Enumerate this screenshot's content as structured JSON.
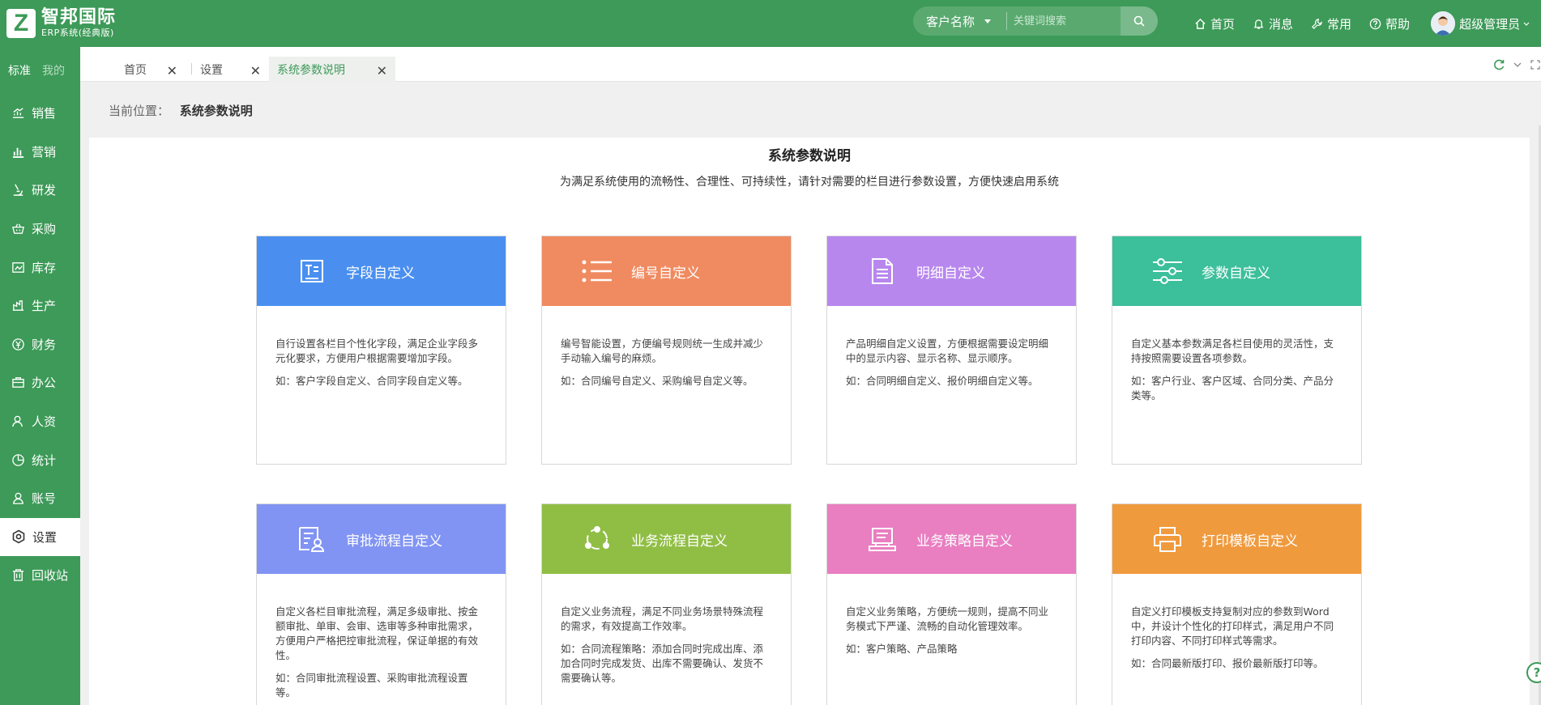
{
  "header": {
    "logo_letter": "Z",
    "logo_name": "智邦国际",
    "logo_sub": "ERP系统(经典版)",
    "search": {
      "selected": "客户名称",
      "placeholder": "关键词搜索"
    },
    "nav": [
      {
        "label": "首页",
        "icon": "home-icon"
      },
      {
        "label": "消息",
        "icon": "bell-icon"
      },
      {
        "label": "常用",
        "icon": "wrench-icon"
      },
      {
        "label": "帮助",
        "icon": "help-icon"
      }
    ],
    "user": "超级管理员"
  },
  "sidebar": {
    "tabs": [
      "标准",
      "我的"
    ],
    "items": [
      {
        "label": "销售",
        "icon": "sales-chart-icon"
      },
      {
        "label": "营销",
        "icon": "bar-chart-icon"
      },
      {
        "label": "研发",
        "icon": "microscope-icon"
      },
      {
        "label": "采购",
        "icon": "basket-icon"
      },
      {
        "label": "库存",
        "icon": "warehouse-icon"
      },
      {
        "label": "生产",
        "icon": "production-icon"
      },
      {
        "label": "财务",
        "icon": "yen-icon"
      },
      {
        "label": "办公",
        "icon": "briefcase-icon"
      },
      {
        "label": "人资",
        "icon": "person-icon"
      },
      {
        "label": "统计",
        "icon": "pie-icon"
      },
      {
        "label": "账号",
        "icon": "account-icon"
      },
      {
        "label": "设置",
        "icon": "gear-icon",
        "active": true
      },
      {
        "label": "回收站",
        "icon": "trash-icon"
      }
    ]
  },
  "tabs": [
    {
      "label": "首页"
    },
    {
      "label": "设置"
    },
    {
      "label": "系统参数说明",
      "active": true
    }
  ],
  "breadcrumb": {
    "label": "当前位置：",
    "value": "系统参数说明"
  },
  "page": {
    "title": "系统参数说明",
    "description": "为满足系统使用的流畅性、合理性、可持续性，请针对需要的栏目进行参数设置，方便快速启用系统"
  },
  "cards": [
    {
      "title": "字段自定义",
      "color": "#4a8ff0",
      "icon": "field-icon",
      "desc": "自行设置各栏目个性化字段，满足企业字段多元化要求，方便用户根据需要增加字段。",
      "example": "如：客户字段自定义、合同字段自定义等。"
    },
    {
      "title": "编号自定义",
      "color": "#f08a60",
      "icon": "list-icon",
      "desc": "编号智能设置，方便编号规则统一生成并减少手动输入编号的麻烦。",
      "example": "如：合同编号自定义、采购编号自定义等。"
    },
    {
      "title": "明细自定义",
      "color": "#b887ee",
      "icon": "document-icon",
      "desc": "产品明细自定义设置，方便根据需要设定明细中的显示内容、显示名称、显示顺序。",
      "example": "如：合同明细自定义、报价明细自定义等。"
    },
    {
      "title": "参数自定义",
      "color": "#3cbf9b",
      "icon": "sliders-icon",
      "desc": "自定义基本参数满足各栏目使用的灵活性，支持按照需要设置各项参数。",
      "example": "如：客户行业、客户区域、合同分类、产品分类等。"
    },
    {
      "title": "审批流程自定义",
      "color": "#8194f3",
      "icon": "approval-icon",
      "desc": "自定义各栏目审批流程，满足多级审批、按金额审批、单审、会审、选审等多种审批需求，方便用户严格把控审批流程，保证单据的有效性。",
      "example": "如：合同审批流程设置、采购审批流程设置等。"
    },
    {
      "title": "业务流程自定义",
      "color": "#90be45",
      "icon": "workflow-icon",
      "desc": "自定义业务流程，满足不同业务场景特殊流程的需求，有效提高工作效率。",
      "example": "如：合同流程策略：添加合同时完成出库、添加合同时完成发货、出库不需要确认、发货不需要确认等。"
    },
    {
      "title": "业务策略自定义",
      "color": "#e97ec1",
      "icon": "strategy-icon",
      "desc": "自定义业务策略，方便统一规则，提高不同业务模式下严谨、流畅的自动化管理效率。",
      "example": "如：客户策略、产品策略"
    },
    {
      "title": "打印模板自定义",
      "color": "#f09a3e",
      "icon": "printer-icon",
      "desc": "自定义打印模板支持复制对应的参数到Word中，并设计个性化的打印样式，满足用户不同打印内容、不同打印样式等需求。",
      "example": "如：合同最新版打印、报价最新版打印等。"
    }
  ]
}
